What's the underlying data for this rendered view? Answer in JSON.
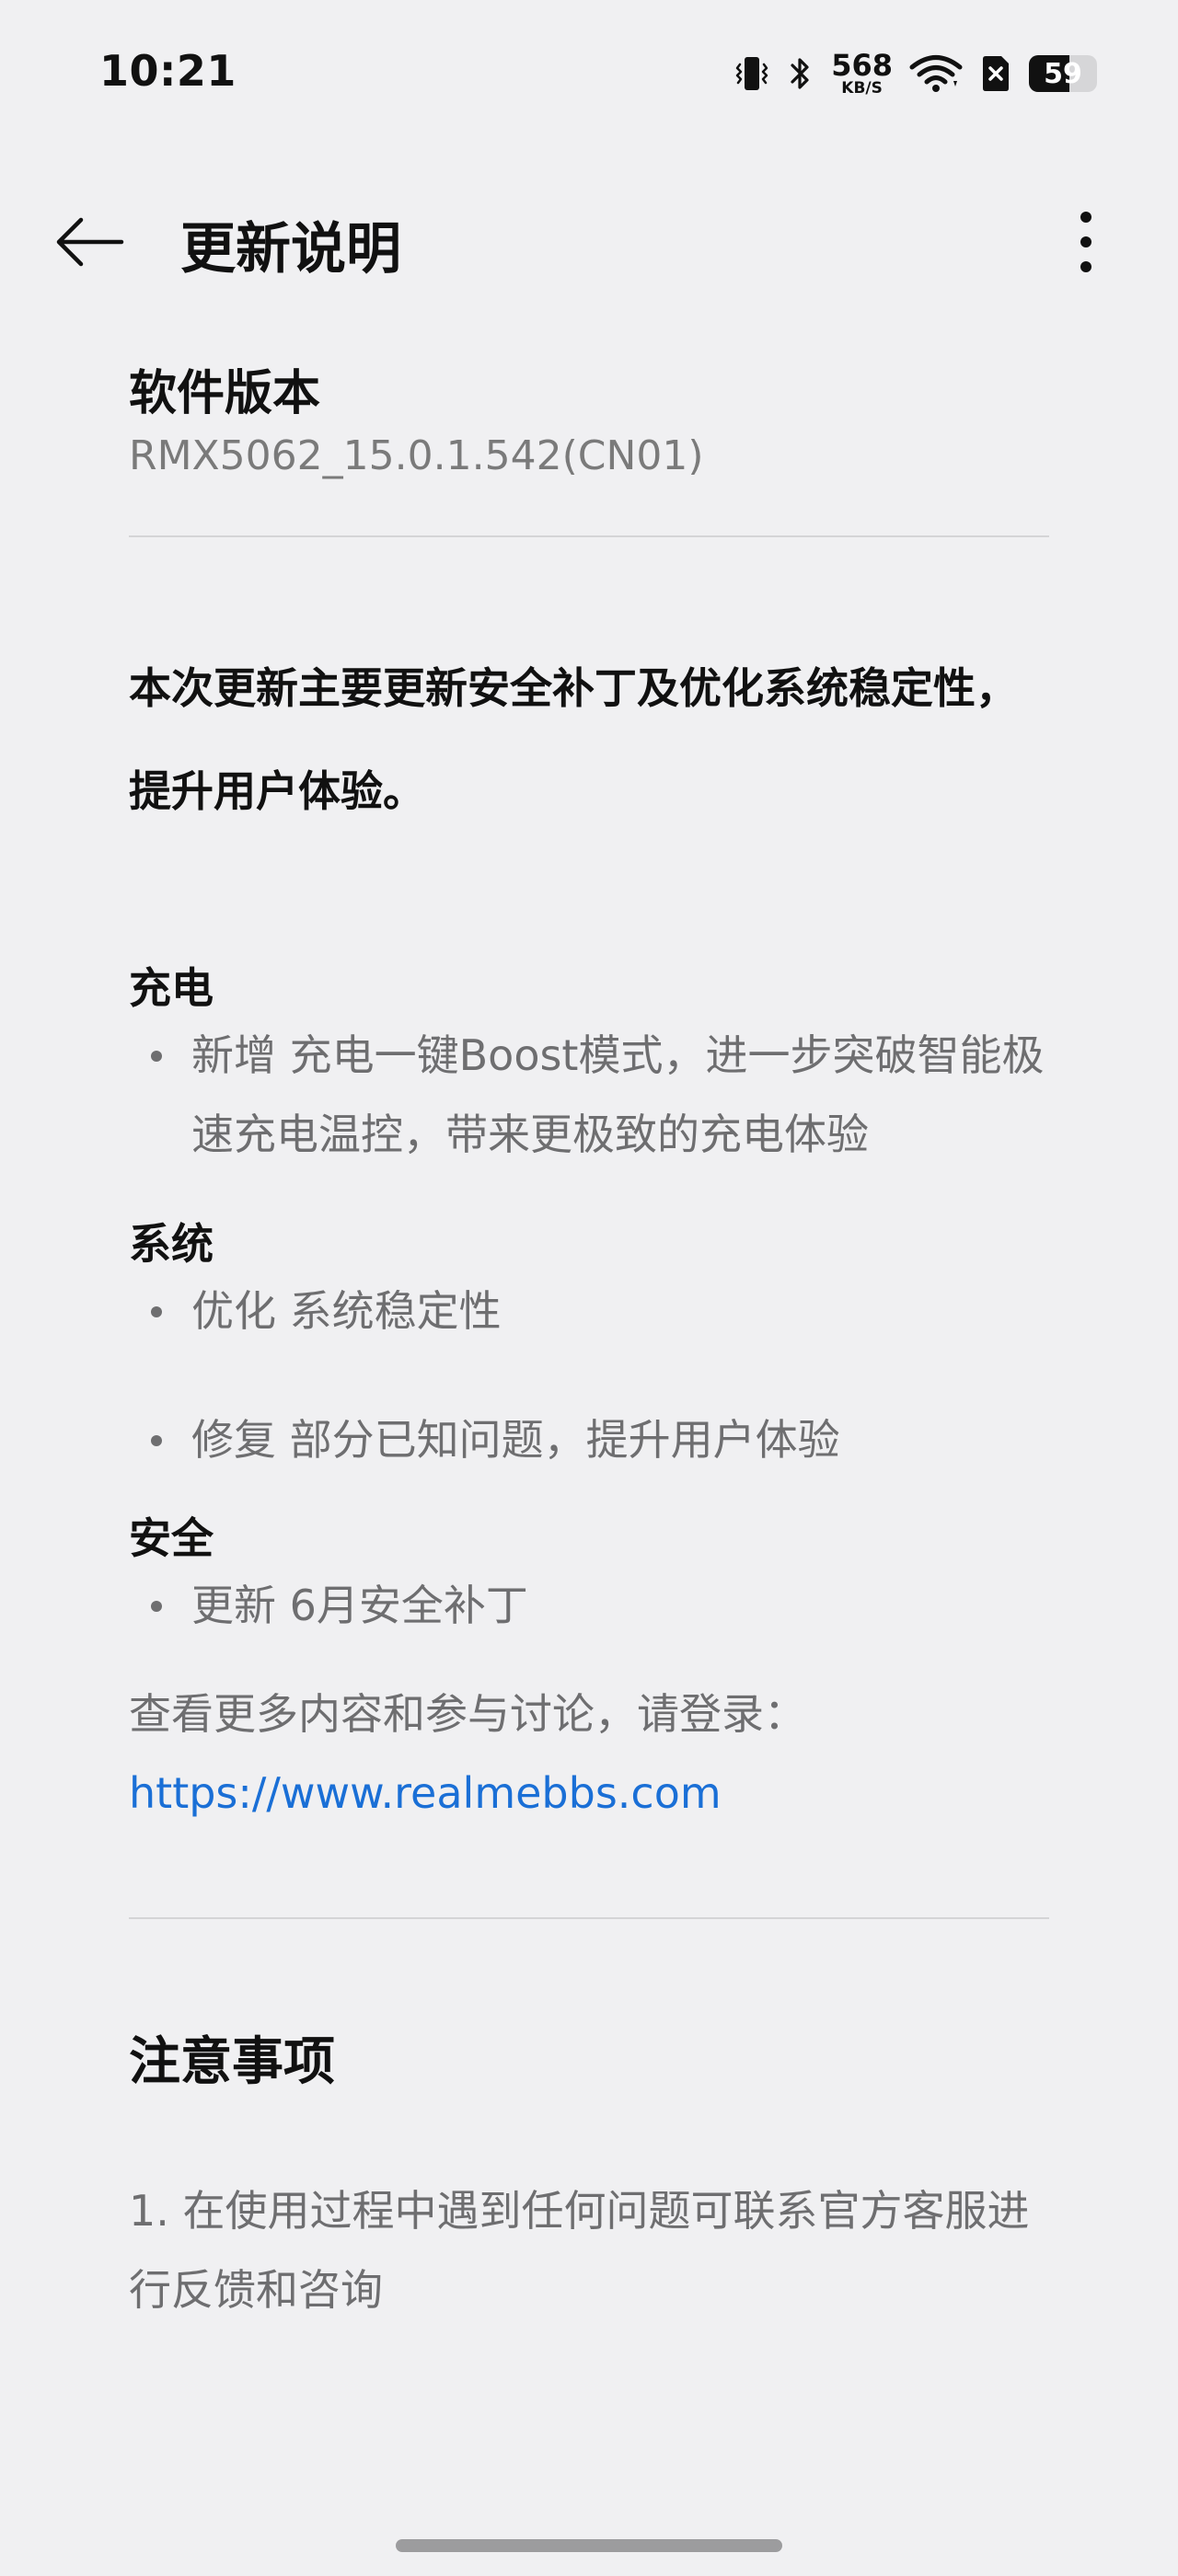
{
  "status_bar": {
    "time": "10:21",
    "net_speed_value": "568",
    "net_speed_unit": "KB/S",
    "battery_level": "59",
    "battery_fraction": 0.59,
    "icons": [
      "vibrate-icon",
      "bluetooth-icon",
      "wifi-icon",
      "no-sim-icon",
      "battery-icon"
    ]
  },
  "app_bar": {
    "title": "更新说明",
    "back_icon": "back-arrow-icon",
    "menu_icon": "more-vertical-icon"
  },
  "version": {
    "label": "软件版本",
    "value": "RMX5062_15.0.1.542(CN01)"
  },
  "summary": "本次更新主要更新安全补丁及优化系统稳定性，提升用户体验。",
  "sections": {
    "charge": {
      "heading": "充电",
      "items": [
        "新增 充电一键Boost模式，进一步突破智能极速充电温控，带来更极致的充电体验"
      ]
    },
    "system": {
      "heading": "系统",
      "items": [
        "优化 系统稳定性",
        "修复 部分已知问题，提升用户体验"
      ]
    },
    "security": {
      "heading": "安全",
      "items": [
        "更新 6月安全补丁"
      ]
    }
  },
  "more_info": {
    "text": "查看更多内容和参与讨论，请登录：",
    "link": "https://www.realmebbs.com"
  },
  "notice": {
    "heading": "注意事项",
    "item_1": "1. 在使用过程中遇到任何问题可联系官方客服进行反馈和咨询"
  },
  "colors": {
    "background": "#f0f0f2",
    "link": "#1a6fd6",
    "secondary_text": "#6e6e70"
  }
}
